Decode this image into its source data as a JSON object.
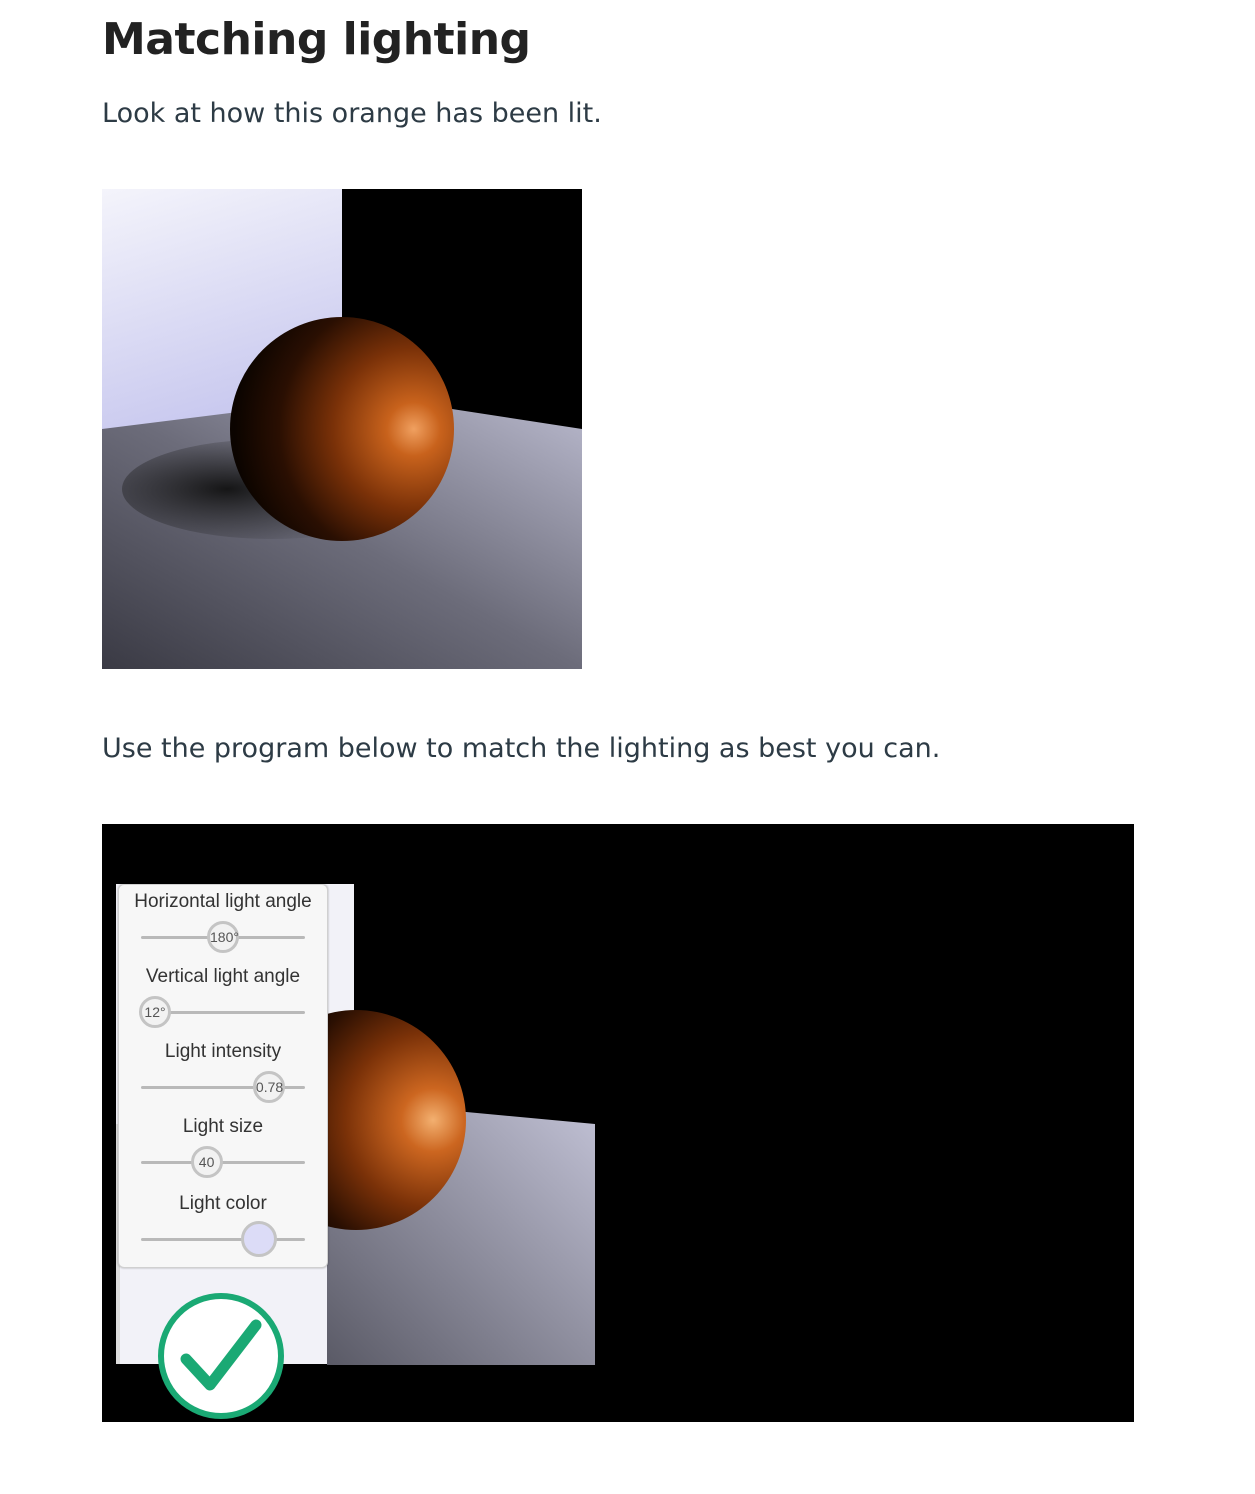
{
  "page": {
    "title": "Matching lighting",
    "intro": "Look at how this orange has been lit.",
    "instruction": "Use the program below to match the lighting as best you can."
  },
  "reference_image": {
    "subject": "lit orange sphere",
    "wall_color": "#dcdcf6",
    "floor_color": "#8a8aa0",
    "orange_color": "#b4520f"
  },
  "program": {
    "controls": [
      {
        "label": "Horizontal light angle",
        "value": "180°",
        "fraction": 0.5
      },
      {
        "label": "Vertical light angle",
        "value": "12°",
        "fraction": 0.07
      },
      {
        "label": "Light intensity",
        "value": "0.78",
        "fraction": 0.78
      },
      {
        "label": "Light size",
        "value": "40",
        "fraction": 0.4
      },
      {
        "label": "Light color",
        "value": "",
        "fraction": 0.72,
        "color": "#dcdcf7"
      }
    ],
    "submit_icon": "check-icon",
    "accent_color": "#1aa974"
  }
}
